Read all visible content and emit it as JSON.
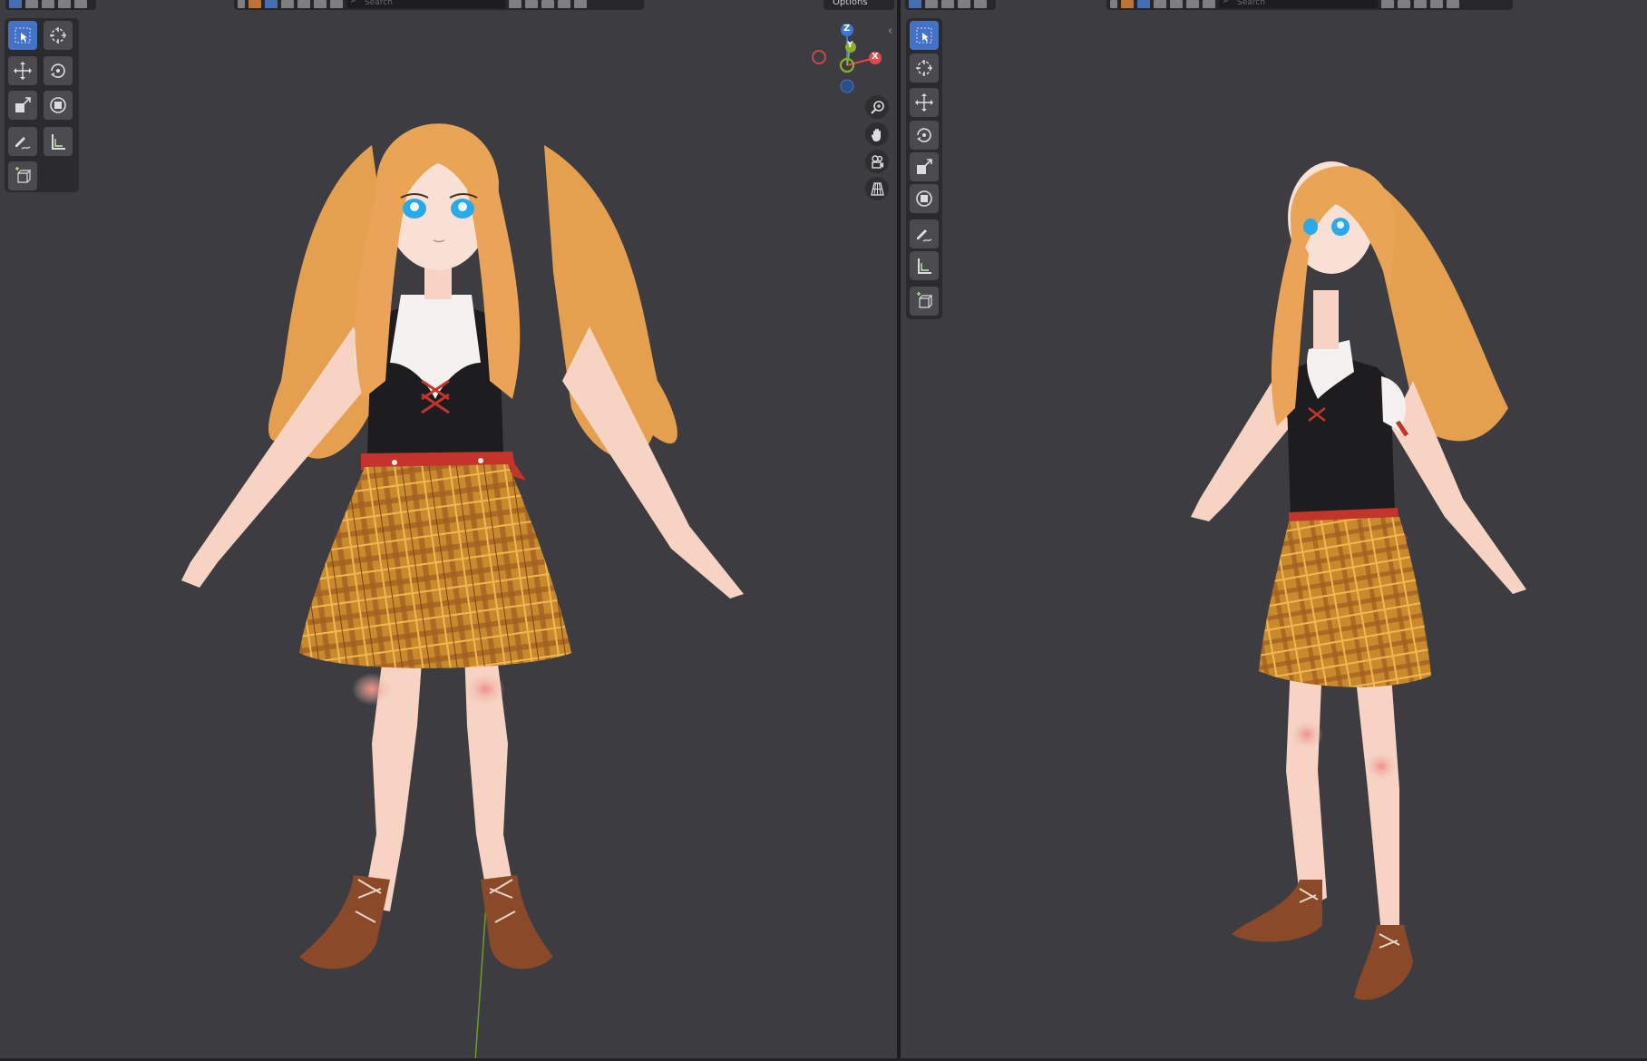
{
  "left_viewport": {
    "header": {
      "search_placeholder": "Search",
      "options_label": "Options"
    },
    "gizmo": {
      "axis_z": "Z",
      "axis_y": "Y",
      "axis_x": "X"
    },
    "tools": [
      "select-box",
      "cursor",
      "move",
      "rotate",
      "scale",
      "transform",
      "annotate",
      "measure",
      "add-cube"
    ],
    "nav_buttons": [
      "zoom",
      "pan",
      "camera",
      "perspective-toggle"
    ]
  },
  "right_viewport": {
    "header": {
      "search_placeholder": "Search"
    },
    "tools": [
      "select-box",
      "cursor",
      "move",
      "rotate",
      "scale",
      "transform",
      "annotate",
      "measure",
      "add-cube"
    ]
  },
  "colors": {
    "viewport_bg": "#3d3c41",
    "active_tool": "#4572c4",
    "axis_x": "#e04a4a",
    "axis_y": "#8aae2f",
    "axis_z": "#3a78d8"
  }
}
